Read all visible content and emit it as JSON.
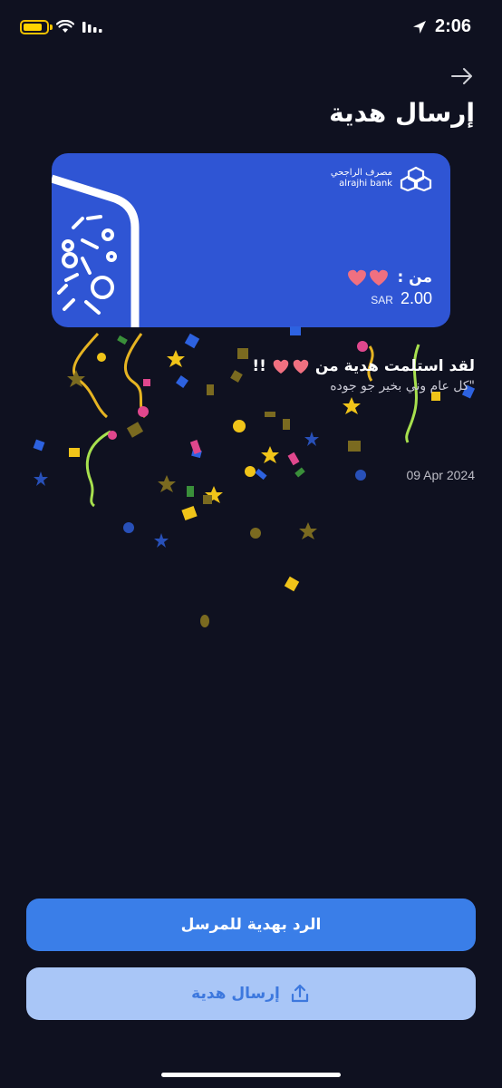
{
  "status_bar": {
    "time": "2:06"
  },
  "header": {
    "title": "إرسال هدية"
  },
  "card": {
    "bank_name_ar": "مصرف الراجحي",
    "bank_name_en": "alrajhi bank",
    "from_label": "من :",
    "currency": "SAR",
    "amount": "2.00"
  },
  "message": {
    "title_before": "لقد استلمت هدية من",
    "title_after": "!!",
    "subtitle": "\"كل عام وني بخير جو جوده",
    "date": "09 Apr 2024"
  },
  "actions": {
    "reply_label": "الرد بهدية للمرسل",
    "send_label": "إرسال هدية"
  },
  "colors": {
    "background": "#0f1120",
    "card": "#2f55d4",
    "primary_button": "#3a7ee8",
    "secondary_button": "#a9c6f7",
    "battery": "#ffd400"
  },
  "icons": [
    "battery-icon",
    "wifi-icon",
    "signal-icon",
    "location-arrow-icon",
    "back-arrow-icon",
    "bank-logo-icon",
    "share-upload-icon"
  ]
}
